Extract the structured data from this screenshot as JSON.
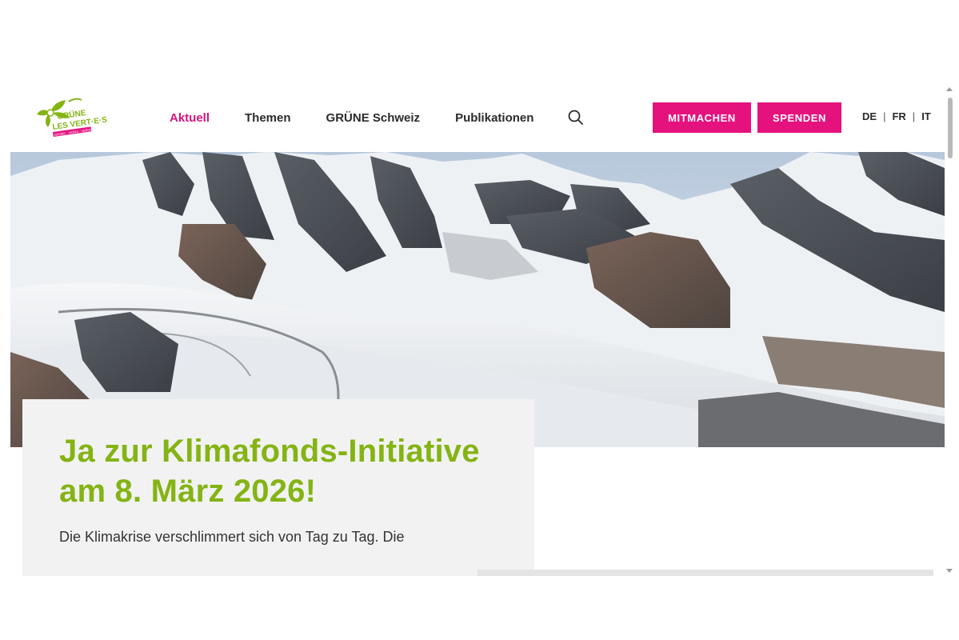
{
  "header": {
    "logo": {
      "line1": "GRÜNE",
      "line2": "LES VERT·E·S",
      "line3": "GRÜNE · VERDI · VERDA"
    },
    "nav": [
      {
        "label": "Aktuell",
        "active": true
      },
      {
        "label": "Themen",
        "active": false
      },
      {
        "label": "GRÜNE Schweiz",
        "active": false
      },
      {
        "label": "Publikationen",
        "active": false
      }
    ],
    "search_icon": "search-icon",
    "cta": {
      "mitmachen": "MITMACHEN",
      "spenden": "SPENDEN"
    },
    "languages": [
      "DE",
      "FR",
      "IT"
    ],
    "language_separator": "|"
  },
  "hero": {
    "image": "glacier-mountain-landscape",
    "title": "Ja zur Klimafonds-Initiative am 8. März 2026!",
    "text": "Die Klimakrise verschlimmert sich von Tag zu Tag. Die"
  },
  "colors": {
    "accent": "#e5127e",
    "nav_active": "#d9127e",
    "title_green": "#84b414",
    "card_bg": "#f2f2f2"
  }
}
